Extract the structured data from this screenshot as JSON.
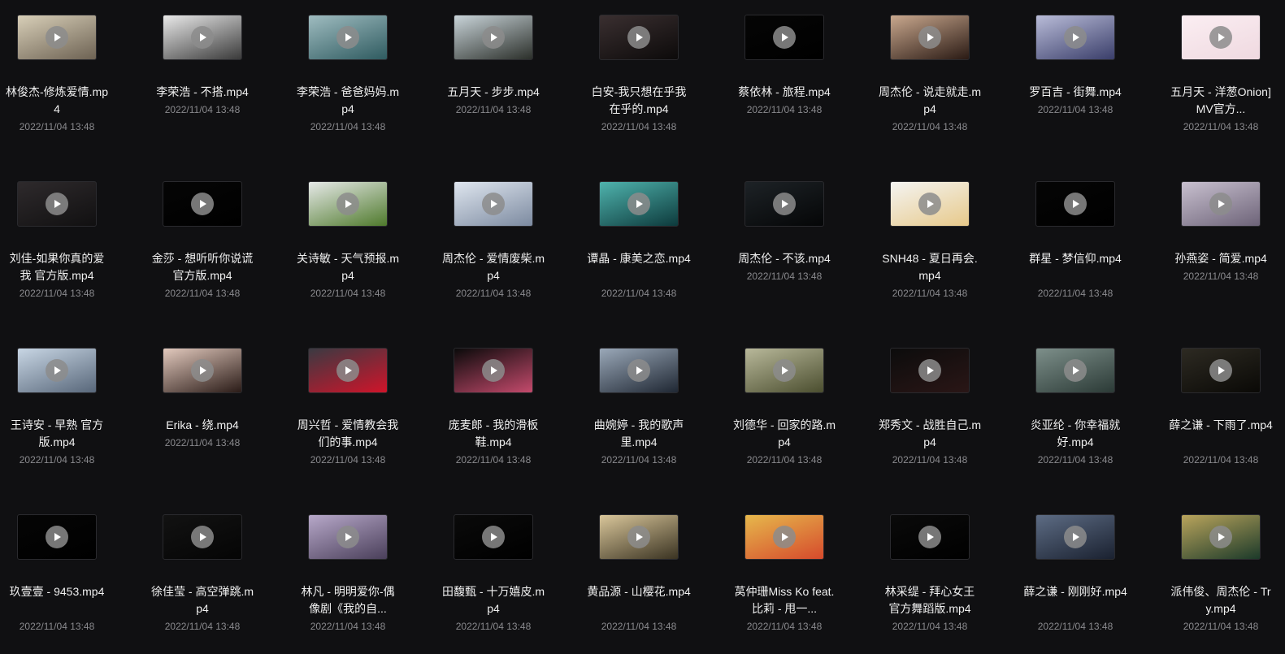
{
  "files": [
    {
      "name": "林俊杰-修炼爱情.mp4",
      "date": "2022/11/04 13:48",
      "lines": 2,
      "thumb": [
        "#d8cfb8",
        "#6d6253"
      ]
    },
    {
      "name": "李荣浩 - 不搭.mp4",
      "date": "2022/11/04 13:48",
      "lines": 1,
      "thumb": [
        "#e9e9e9",
        "#3a3a3a"
      ]
    },
    {
      "name": "李荣浩 - 爸爸妈妈.mp4",
      "date": "2022/11/04 13:48",
      "lines": 2,
      "thumb": [
        "#9fbcc0",
        "#2f5b60"
      ]
    },
    {
      "name": "五月天 - 步步.mp4",
      "date": "2022/11/04 13:48",
      "lines": 1,
      "thumb": [
        "#c9d4d9",
        "#2b2f2a"
      ]
    },
    {
      "name": "白安-我只想在乎我在乎的.mp4",
      "date": "2022/11/04 13:48",
      "lines": 2,
      "thumb": [
        "#3a2f30",
        "#0c0a0a"
      ]
    },
    {
      "name": "蔡依林 - 旅程.mp4",
      "date": "2022/11/04 13:48",
      "lines": 1,
      "thumb": [
        "#050505",
        "#000000"
      ]
    },
    {
      "name": "周杰伦 - 说走就走.mp4",
      "date": "2022/11/04 13:48",
      "lines": 2,
      "thumb": [
        "#c9a88e",
        "#2a1a14"
      ]
    },
    {
      "name": "罗百吉 - 街舞.mp4",
      "date": "2022/11/04 13:48",
      "lines": 1,
      "thumb": [
        "#b9bcd8",
        "#3a3e6a"
      ]
    },
    {
      "name": "五月天 - 洋葱Onion]MV官方...",
      "date": "2022/11/04 13:48",
      "lines": 2,
      "thumb": [
        "#fbeef2",
        "#efd9e0"
      ]
    },
    {
      "name": "刘佳-如果你真的爱我 官方版.mp4",
      "date": "2022/11/04 13:48",
      "lines": 2,
      "thumb": [
        "#2e2a2c",
        "#111011"
      ]
    },
    {
      "name": "金莎 - 想听听你说谎 官方版.mp4",
      "date": "2022/11/04 13:48",
      "lines": 2,
      "thumb": [
        "#050505",
        "#000000"
      ]
    },
    {
      "name": "关诗敏 - 天气预报.mp4",
      "date": "2022/11/04 13:48",
      "lines": 2,
      "thumb": [
        "#e6e9e8",
        "#4f7a2c"
      ]
    },
    {
      "name": "周杰伦 - 爱情废柴.mp4",
      "date": "2022/11/04 13:48",
      "lines": 2,
      "thumb": [
        "#dfe6ef",
        "#7c8aa0"
      ]
    },
    {
      "name": "谭晶 - 康美之恋.mp4",
      "date": "2022/11/04 13:48",
      "lines": 2,
      "thumb": [
        "#4fb3ad",
        "#0d3a3c"
      ]
    },
    {
      "name": "周杰伦 - 不该.mp4",
      "date": "2022/11/04 13:48",
      "lines": 1,
      "thumb": [
        "#1d2226",
        "#050607"
      ]
    },
    {
      "name": "SNH48 - 夏日再会.mp4",
      "date": "2022/11/04 13:48",
      "lines": 2,
      "thumb": [
        "#f4f4f2",
        "#e7c98a"
      ]
    },
    {
      "name": "群星 - 梦信仰.mp4",
      "date": "2022/11/04 13:48",
      "lines": 2,
      "thumb": [
        "#050505",
        "#000000"
      ]
    },
    {
      "name": "孙燕姿 - 简爱.mp4",
      "date": "2022/11/04 13:48",
      "lines": 1,
      "thumb": [
        "#c8c0cf",
        "#6d6378"
      ]
    },
    {
      "name": "王诗安 - 早熟 官方版.mp4",
      "date": "2022/11/04 13:48",
      "lines": 2,
      "thumb": [
        "#c8d6e4",
        "#58677a"
      ]
    },
    {
      "name": "Erika - 绕.mp4",
      "date": "2022/11/04 13:48",
      "lines": 1,
      "thumb": [
        "#e2c9bd",
        "#2a1b17"
      ]
    },
    {
      "name": "周兴哲 - 爱情教会我们的事.mp4",
      "date": "2022/11/04 13:48",
      "lines": 2,
      "thumb": [
        "#3a3a42",
        "#d0142a"
      ]
    },
    {
      "name": "庞麦郎 - 我的滑板鞋.mp4",
      "date": "2022/11/04 13:48",
      "lines": 2,
      "thumb": [
        "#0a0a0a",
        "#c44a6c"
      ]
    },
    {
      "name": "曲婉婷 - 我的歌声里.mp4",
      "date": "2022/11/04 13:48",
      "lines": 2,
      "thumb": [
        "#9aa8b8",
        "#1f2733"
      ]
    },
    {
      "name": "刘德华 - 回家的路.mp4",
      "date": "2022/11/04 13:48",
      "lines": 2,
      "thumb": [
        "#b8b89a",
        "#4b4e2f"
      ]
    },
    {
      "name": "郑秀文 - 战胜自己.mp4",
      "date": "2022/11/04 13:48",
      "lines": 2,
      "thumb": [
        "#0c0c0c",
        "#2a1616"
      ]
    },
    {
      "name": "炎亚纶 - 你幸福就好.mp4",
      "date": "2022/11/04 13:48",
      "lines": 2,
      "thumb": [
        "#7d8f8a",
        "#2b3a36"
      ]
    },
    {
      "name": "薛之谦 - 下雨了.mp4",
      "date": "2022/11/04 13:48",
      "lines": 2,
      "thumb": [
        "#2d2a22",
        "#0a0906"
      ]
    },
    {
      "name": "玖壹壹 - 9453.mp4",
      "date": "2022/11/04 13:48",
      "lines": 2,
      "thumb": [
        "#050505",
        "#000000"
      ]
    },
    {
      "name": "徐佳莹 - 高空弹跳.mp4",
      "date": "2022/11/04 13:48",
      "lines": 2,
      "thumb": [
        "#121212",
        "#050505"
      ]
    },
    {
      "name": "林凡 - 明明爱你-偶像剧《我的自...",
      "date": "2022/11/04 13:48",
      "lines": 2,
      "thumb": [
        "#b7a8c9",
        "#4a3f5a"
      ]
    },
    {
      "name": "田馥甄 - 十万嬉皮.mp4",
      "date": "2022/11/04 13:48",
      "lines": 2,
      "thumb": [
        "#0a0a0a",
        "#000000"
      ]
    },
    {
      "name": "黄品源 - 山樱花.mp4",
      "date": "2022/11/04 13:48",
      "lines": 2,
      "thumb": [
        "#d9c69a",
        "#3a3322"
      ]
    },
    {
      "name": "莴仲珊Miss Ko feat. 比莉 - 甩一...",
      "date": "2022/11/04 13:48",
      "lines": 2,
      "thumb": [
        "#e6b84c",
        "#d64a2c"
      ]
    },
    {
      "name": "林采缇 - 拜心女王 官方舞蹈版.mp4",
      "date": "2022/11/04 13:48",
      "lines": 2,
      "thumb": [
        "#0a0a0a",
        "#000000"
      ]
    },
    {
      "name": "薛之谦 - 刚刚好.mp4",
      "date": "2022/11/04 13:48",
      "lines": 2,
      "thumb": [
        "#5d6c84",
        "#1a2130"
      ]
    },
    {
      "name": "派伟俊、周杰伦 - Try.mp4",
      "date": "2022/11/04 13:48",
      "lines": 2,
      "thumb": [
        "#b9a45c",
        "#1c3a2a"
      ]
    }
  ]
}
